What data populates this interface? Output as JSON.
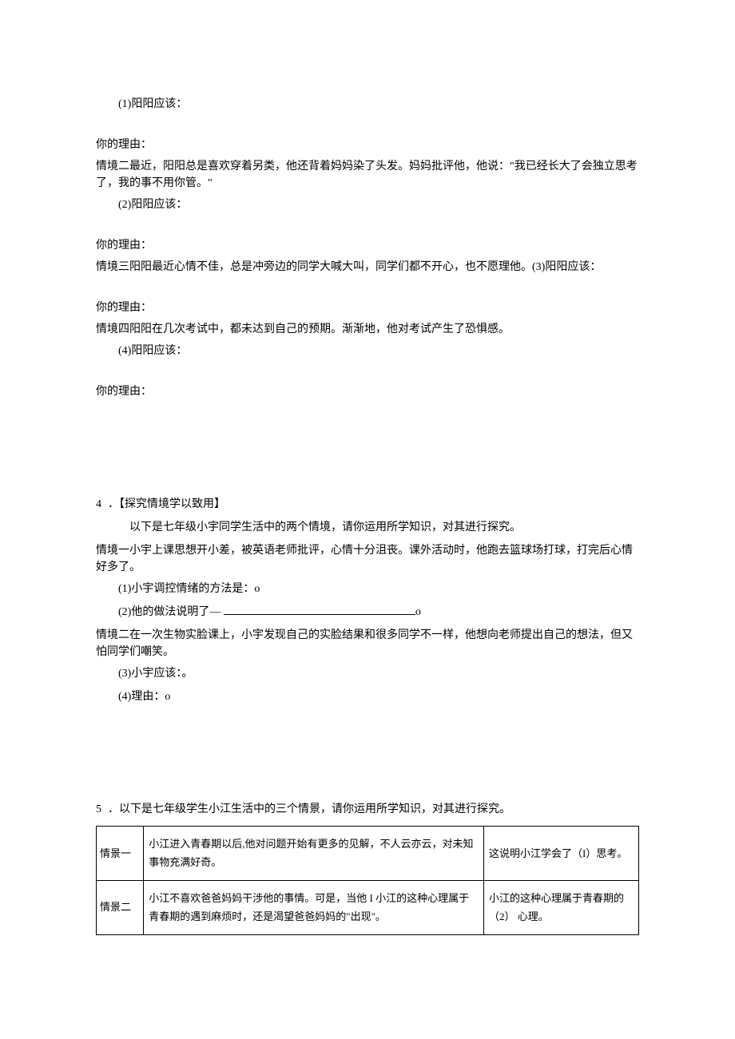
{
  "q3": {
    "item1": {
      "prompt": "(1)阳阳应该：",
      "reason_label": "你的理由："
    },
    "scenario2": "情境二最近，阳阳总是喜欢穿着另类，他还背着妈妈染了头发。妈妈批评他，他说：\"我已经长大了会独立思考了，我的事不用你管。\"",
    "item2": {
      "prompt": "(2)阳阳应该：",
      "reason_label": "你的理由："
    },
    "scenario3": "情境三阳阳最近心情不佳，总是冲旁边的同学大喊大叫，同学们都不开心，也不愿理他。(3)阳阳应该：",
    "item3": {
      "reason_label": "你的理由："
    },
    "scenario4": "情境四阳阳在几次考试中，都未达到自己的预期。渐渐地，他对考试产生了恐惧感。",
    "item4": {
      "prompt": "(4)阳阳应该：",
      "reason_label": "你的理由："
    }
  },
  "q4": {
    "number": "4",
    "title": "．【探究情境学以致用】",
    "intro": "以下是七年级小宇同学生活中的两个情境，请你运用所学知识，对其进行探究。",
    "scenario1": "情境一小宇上课思想开小差，被英语老师批评，心情十分沮丧。课外活动时，他跑去篮球场打球，打完后心情好多了。",
    "sub1": "(1)小宇调控情绪的方法是：o",
    "sub2_prefix": "(2)他的做法说明了— ",
    "sub2_suffix": "o",
    "scenario2": "情境二在一次生物实脸课上，小宇发现自己的实脸结果和很多同学不一样，他想向老师提出自己的想法，但又怕同学们嘲笑。",
    "sub3": "(3)小宇应该：。",
    "sub4": "(4)理由：o"
  },
  "q5": {
    "number": "5",
    "intro": "．以下是七年级学生小江生活中的三个情景，请你运用所学知识，对其进行探究。",
    "table": {
      "row1": {
        "label": "情景一",
        "desc": "小江进入青春期以后,他对问题开始有更多的见解，不人云亦云，对未知事物充满好奇。",
        "conclusion": "这说明小江学会了（I）思考。"
      },
      "row2": {
        "label": "情景二",
        "desc": "小江不喜欢爸爸妈妈干涉他的事情。可是，当他 I 小江的这种心理属于青春期的遇到麻烦时，还是渴望爸爸妈妈的\"出现\"。",
        "conclusion": "小江的这种心理属于青春期的（2） 心理。"
      }
    }
  }
}
